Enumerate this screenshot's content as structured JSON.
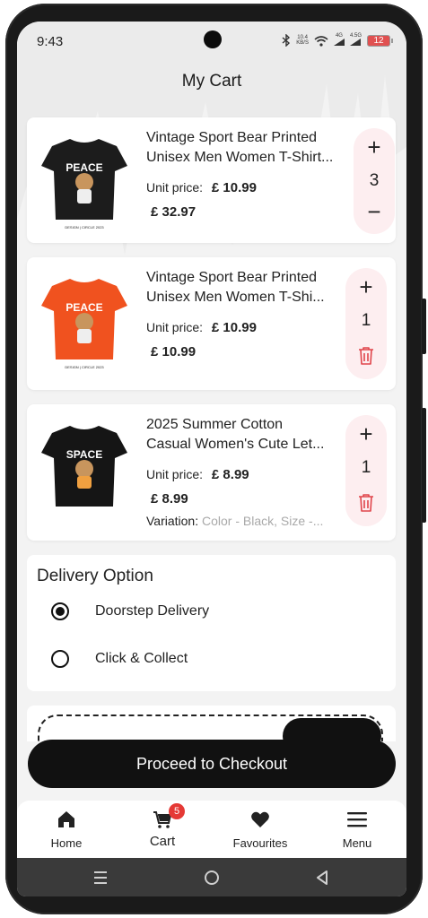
{
  "status_bar": {
    "time": "9:43",
    "net_speed_top": "10.4",
    "net_speed_bottom": "KB/S",
    "sig1": "4G",
    "sig2": "4.5G",
    "battery": "12"
  },
  "page_title": "My Cart",
  "cart_items": [
    {
      "title_line1": "Vintage Sport Bear Printed",
      "title_line2": "Unisex Men Women T-Shirt...",
      "unit_price_label": "Unit price:",
      "unit_price": "£ 10.99",
      "total": "£ 32.97",
      "quantity": "3",
      "thumb_text": "PEACE",
      "thumb_caption": "DESIGN | CIRCLE 2023",
      "shirt_color": "#1c1c1c"
    },
    {
      "title_line1": "Vintage Sport Bear Printed",
      "title_line2": "Unisex Men Women T-Shi...",
      "unit_price_label": "Unit price:",
      "unit_price": "£ 10.99",
      "total": "£ 10.99",
      "quantity": "1",
      "thumb_text": "PEACE",
      "thumb_caption": "DESIGN | CIRCLE 2023",
      "shirt_color": "#f0521f"
    },
    {
      "title_line1": "2025 Summer Cotton",
      "title_line2": "Casual Women's Cute Let...",
      "unit_price_label": "Unit price:",
      "unit_price": "£ 8.99",
      "total": "£ 8.99",
      "quantity": "1",
      "variation_label": "Variation:",
      "variation_value": "Color - Black,  Size -...",
      "thumb_text": "SPACE",
      "shirt_color": "#151515"
    }
  ],
  "delivery": {
    "title": "Delivery Option",
    "options": [
      {
        "label": "Doorstep Delivery",
        "selected": true
      },
      {
        "label": "Click & Collect",
        "selected": false
      }
    ]
  },
  "checkout_button": "Proceed to Checkout",
  "bottom_nav": {
    "items": [
      {
        "label": "Home",
        "icon": "home-icon"
      },
      {
        "label": "Cart",
        "icon": "cart-icon",
        "badge": "5",
        "active": true
      },
      {
        "label": "Favourites",
        "icon": "heart-icon"
      },
      {
        "label": "Menu",
        "icon": "menu-icon"
      }
    ]
  },
  "colors": {
    "accent": "#111111",
    "stepper_bg": "#fdeef0",
    "trash": "#e0454b",
    "badge": "#e53935"
  }
}
